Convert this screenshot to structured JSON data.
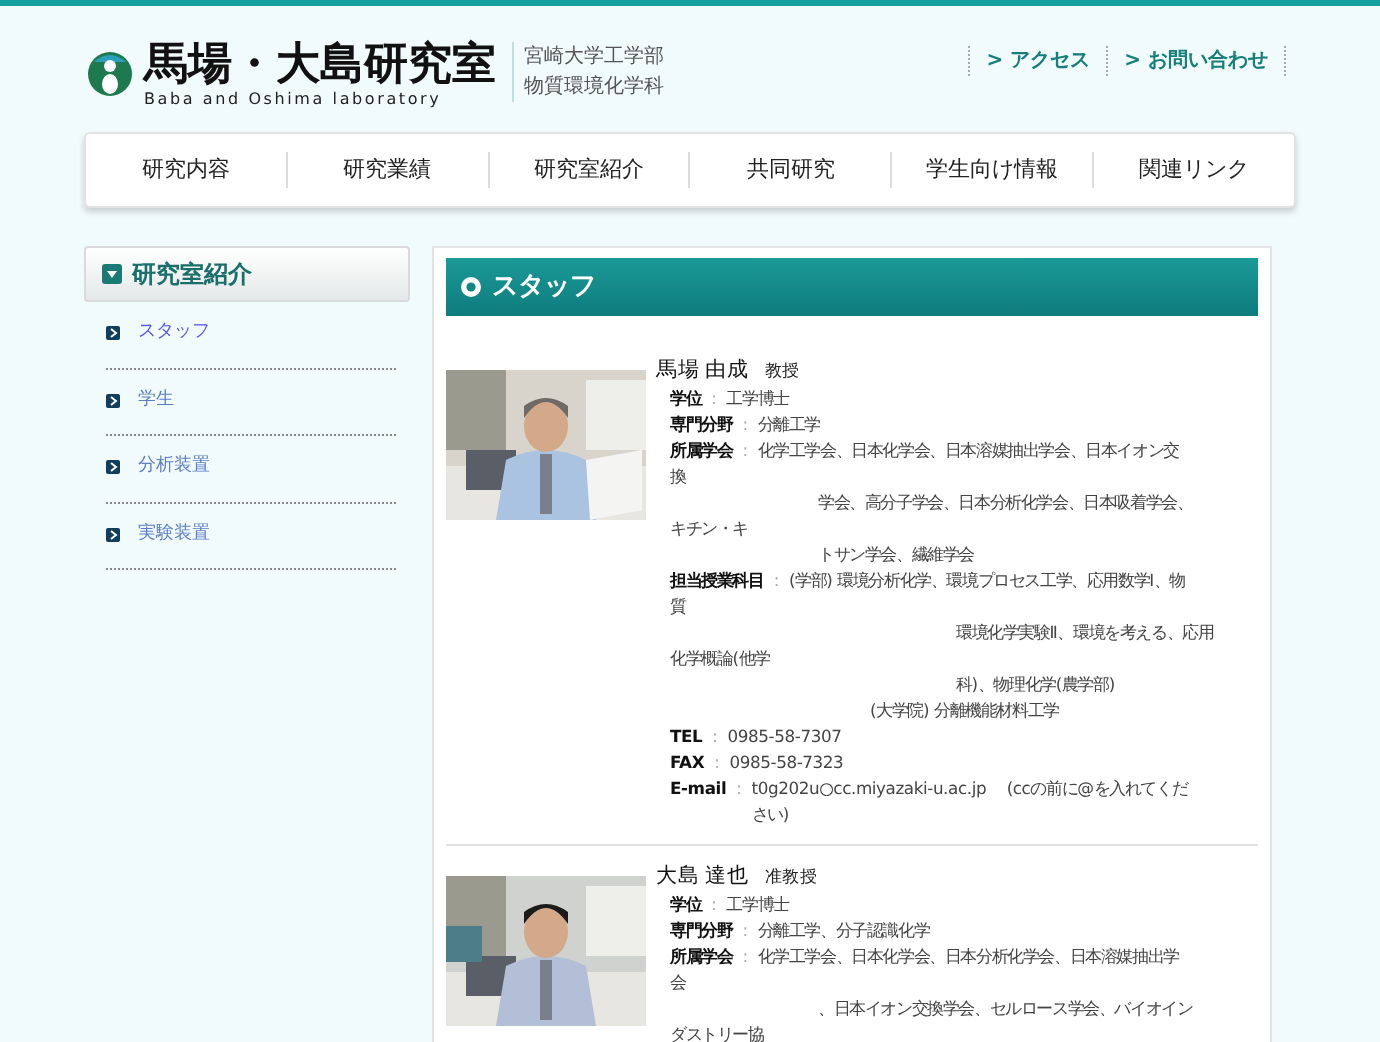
{
  "header": {
    "title": "馬場・大島研究室",
    "subtitle": "Baba and Oshima laboratory",
    "department": [
      "宮崎大学工学部",
      "物質環境化学科"
    ],
    "links": [
      "> アクセス",
      "> お問い合わせ"
    ]
  },
  "nav": [
    "研究内容",
    "研究業績",
    "研究室紹介",
    "共同研究",
    "学生向け情報",
    "関連リンク"
  ],
  "sidebar": {
    "heading": "研究室紹介",
    "items": [
      {
        "label": "スタッフ",
        "selected": true
      },
      {
        "label": "学生",
        "selected": false
      },
      {
        "label": "分析装置",
        "selected": false
      },
      {
        "label": "実験装置",
        "selected": false
      }
    ]
  },
  "main": {
    "heading": "スタッフ",
    "staff": [
      {
        "name": "馬場 由成",
        "position": "教授",
        "lines": [
          {
            "kind": "field",
            "label": "学位",
            "sep": ":",
            "value": "工学博士"
          },
          {
            "kind": "field",
            "label": "専門分野",
            "sep": ":",
            "value": "分離工学"
          },
          {
            "kind": "field",
            "label": "所属学会",
            "sep": ":",
            "value": "化学工学会、日本化学会、日本溶媒抽出学会、日本イオン交"
          },
          {
            "kind": "wrap",
            "value": "換"
          },
          {
            "kind": "indent",
            "value": "学会、高分子学会、日本分析化学会、日本吸着学会、"
          },
          {
            "kind": "wrap",
            "value": "キチン・キ"
          },
          {
            "kind": "indent",
            "value": "トサン学会、繊維学会"
          },
          {
            "kind": "field",
            "label": "担当授業科目",
            "sep": ":",
            "value": "(学部) 環境分析化学、環境プロセス工学、応用数学Ⅰ、物"
          },
          {
            "kind": "wrap",
            "value": "質"
          },
          {
            "kind": "indent_wide",
            "value": "環境化学実験Ⅱ、環境を考える、応用"
          },
          {
            "kind": "wrap",
            "value": "化学概論(他学"
          },
          {
            "kind": "indent_wide",
            "value": "科)、物理化学(農学部)"
          },
          {
            "kind": "indent_mid",
            "value": "(大学院) 分離機能材料工学"
          },
          {
            "kind": "field",
            "label": "TEL",
            "sep": ":",
            "value": "0985-58-7307"
          },
          {
            "kind": "field",
            "label": "FAX",
            "sep": ":",
            "value": "0985-58-7323"
          },
          {
            "kind": "field",
            "label": "E-mail",
            "sep": ":",
            "value": "t0g202u○cc.miyazaki-u.ac.jp　 (ccの前に@を入れてください)"
          }
        ]
      },
      {
        "name": "大島 達也",
        "position": "准教授",
        "lines": [
          {
            "kind": "field",
            "label": "学位",
            "sep": ":",
            "value": "工学博士"
          },
          {
            "kind": "field",
            "label": "専門分野",
            "sep": ":",
            "value": "分離工学、分子認識化学"
          },
          {
            "kind": "field",
            "label": "所属学会",
            "sep": ":",
            "value": "化学工学会、日本化学会、日本分析化学会、日本溶媒抽出学"
          },
          {
            "kind": "wrap",
            "value": "会"
          },
          {
            "kind": "indent",
            "value": "、日本イオン交換学会、セルロース学会、バイオイン"
          },
          {
            "kind": "wrap",
            "value": "ダストリー協"
          }
        ]
      }
    ]
  }
}
